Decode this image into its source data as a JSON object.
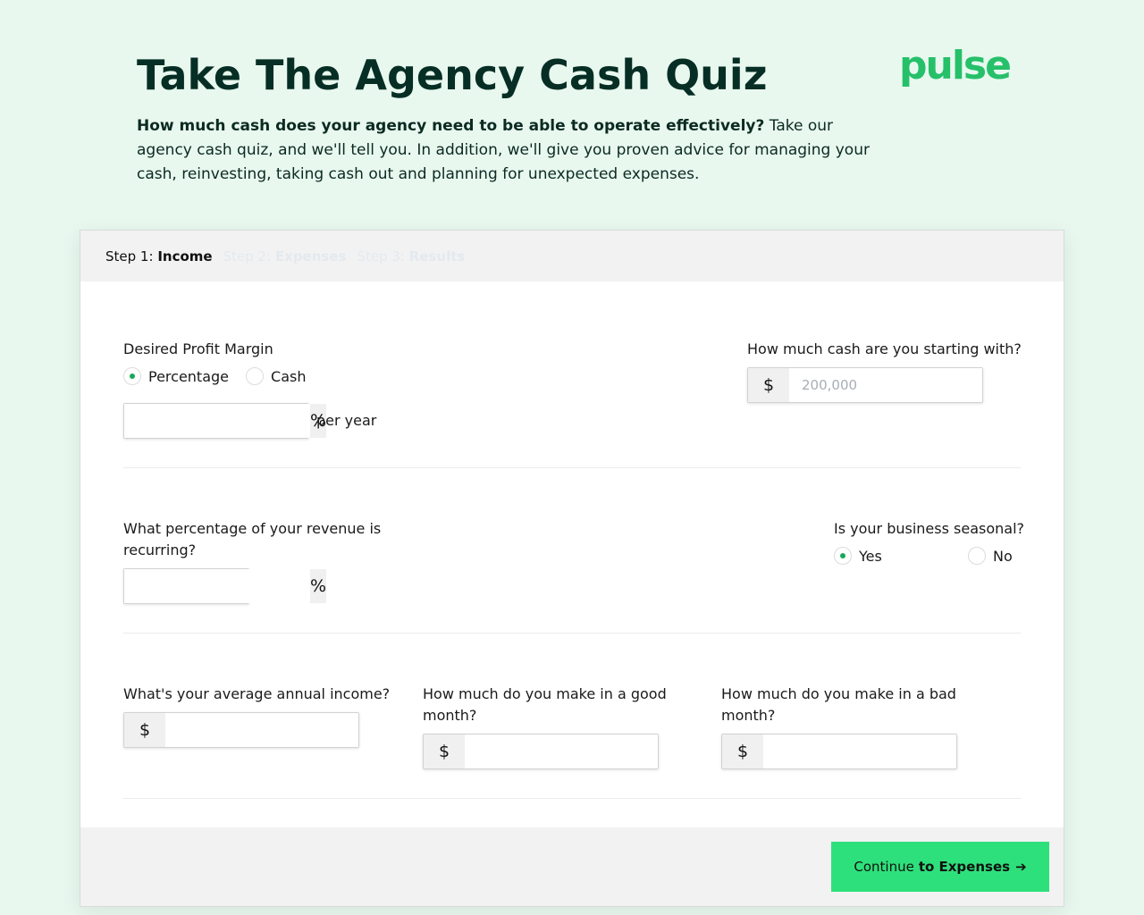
{
  "header": {
    "title": "Take The Agency Cash Quiz",
    "intro_bold": "How much cash does your agency need to be able to operate effectively?",
    "intro_rest": " Take our agency cash quiz, and we'll tell you. In addition, we'll give you proven advice for managing your cash, reinvesting, taking cash out and planning for unexpected expenses.",
    "logo": "pulse"
  },
  "steps": [
    {
      "prefix": "Step 1:",
      "name": "Income",
      "active": true
    },
    {
      "prefix": "Step 2:",
      "name": "Expenses",
      "active": false
    },
    {
      "prefix": "Step 3:",
      "name": "Results",
      "active": false
    }
  ],
  "profit_margin": {
    "label": "Desired Profit Margin",
    "options": [
      "Percentage",
      "Cash"
    ],
    "selected": "Percentage",
    "value": "",
    "unit": "%",
    "suffix": "per year"
  },
  "starting_cash": {
    "label": "How much cash are you starting with?",
    "currency": "$",
    "value": "",
    "placeholder": "200,000"
  },
  "recurring": {
    "label": "What percentage of your revenue is recurring?",
    "value": "",
    "unit": "%"
  },
  "seasonal": {
    "label": "Is your business seasonal?",
    "options": [
      "Yes",
      "No"
    ],
    "selected": "Yes"
  },
  "annual_income": {
    "label": "What's your average annual income?",
    "currency": "$",
    "value": ""
  },
  "good_month": {
    "label": "How much do you make in a good month?",
    "currency": "$",
    "value": ""
  },
  "bad_month": {
    "label": "How much do you make in a bad month?",
    "currency": "$",
    "value": ""
  },
  "footer": {
    "continue_prefix": "Continue",
    "continue_bold": "to Expenses",
    "arrow": "➔"
  },
  "colors": {
    "page_bg": "#e8f8ef",
    "brand_green": "#27c06a",
    "button_green": "#2ee07b",
    "radio_dot": "#18a85a"
  }
}
